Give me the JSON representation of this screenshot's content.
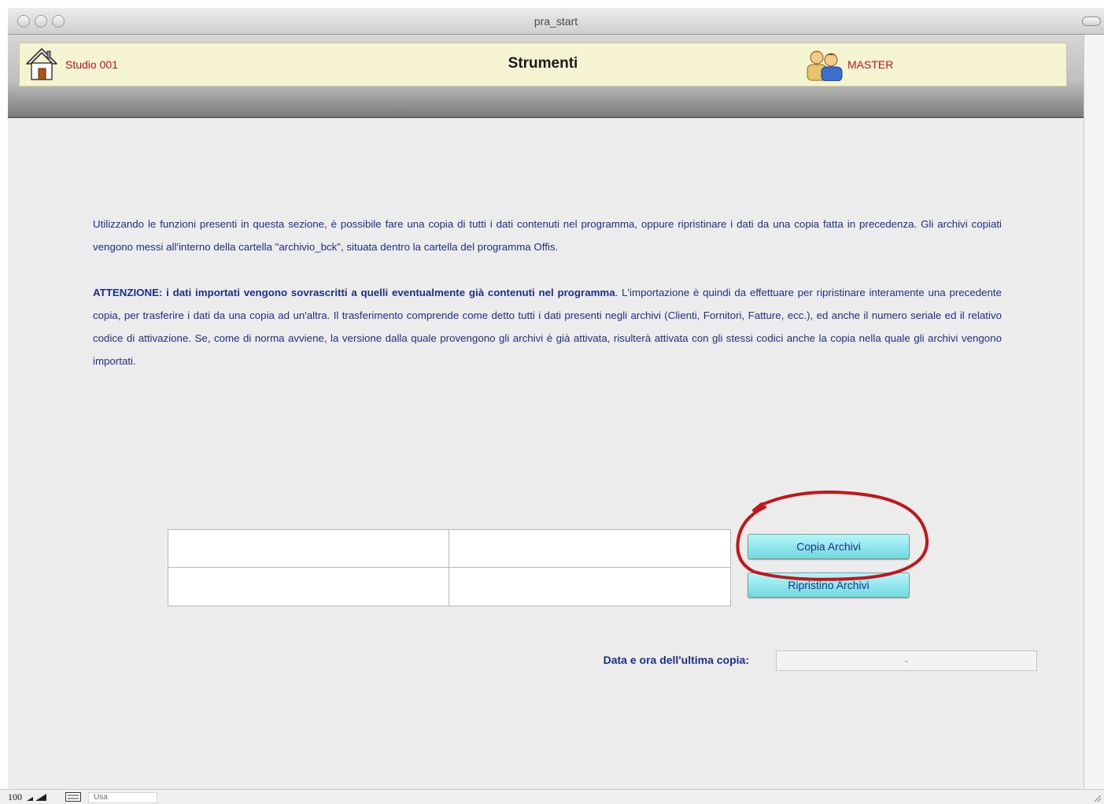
{
  "window": {
    "title": "pra_start"
  },
  "header": {
    "studio_label": "Studio 001",
    "section_title": "Strumenti",
    "user_label": "MASTER",
    "accent_color": "#d0101a",
    "panel_color": "#f4f4d2"
  },
  "description": {
    "paragraph1": "Utilizzando le funzioni presenti in questa sezione, è possibile fare una copia di tutti i dati contenuti nel programma, oppure ripristinare i dati da una copia fatta in precedenza. Gli archivi copiati vengono messi all'interno della cartella \"archivio_bck\", situata dentro la cartella del programma Offis.",
    "paragraph2_bold": "ATTENZIONE: i dati importati vengono sovrascritti a quelli eventualmente già contenuti nel programma",
    "paragraph2_rest": ". L'importazione è quindi da effettuare per ripristinare interamente una precedente copia, per trasferire i dati da una copia ad un'altra. Il trasferimento comprende come detto tutti i dati presenti negli archivi (Clienti, Fornitori, Fatture, ecc.), ed anche il numero seriale ed il relativo codice di attivazione. Se, come di norma avviene, la versione dalla quale provengono gli archivi è già attivata, risulterà attivata con gli stessi codici anche la copia nella quale gli archivi vengono importati.",
    "text_color": "#1e2f86"
  },
  "actions": {
    "copia_label": "Copia Archivi",
    "ripristino_label": "Ripristino Archivi",
    "button_color": "#8ee6ec",
    "highlight_color": "#c0161c"
  },
  "last_copy": {
    "label": "Data e ora dell'ultima copia:",
    "value": "-"
  },
  "statusbar": {
    "zoom": "100",
    "mode": "Usa"
  }
}
